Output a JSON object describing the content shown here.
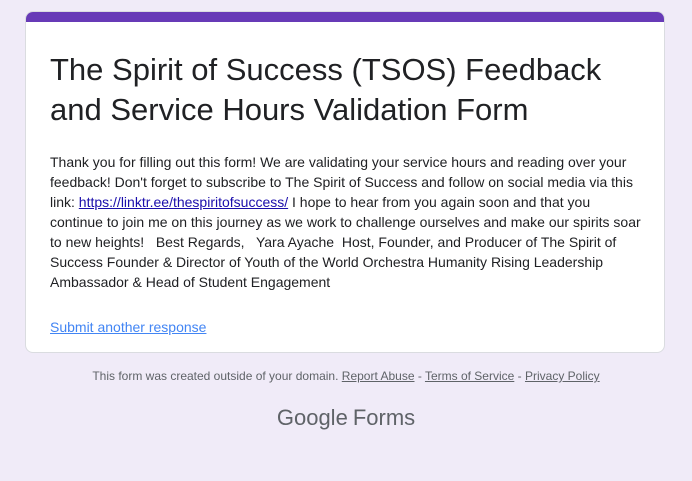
{
  "form": {
    "title": "The Spirit of Success (TSOS) Feedback and Service Hours Validation Form",
    "description_before_link": "Thank you for filling out this form! We are validating your service hours and reading over your feedback! Don't forget to subscribe to The Spirit of Success and follow on social media via this link: ",
    "description_link": "https://linktr.ee/thespiritofsuccess/",
    "description_after_link": " I hope to hear from you again soon and that you continue to join me on this journey as we work to challenge ourselves and make our spirits soar to new heights!   Best Regards,   Yara Ayache  Host, Founder, and Producer of The Spirit of Success Founder & Director of Youth of the World Orchestra Humanity Rising Leadership Ambassador & Head of Student Engagement",
    "submit_another_label": "Submit another response"
  },
  "footer": {
    "notice": "This form was created outside of your domain.",
    "report_abuse": "Report Abuse",
    "separator": " - ",
    "terms": "Terms of Service",
    "privacy": "Privacy Policy"
  },
  "brand": {
    "google": "Google",
    "product": "Forms"
  },
  "colors": {
    "accent": "#673ab7",
    "background": "#f0ebf8",
    "link": "#4285f4"
  }
}
